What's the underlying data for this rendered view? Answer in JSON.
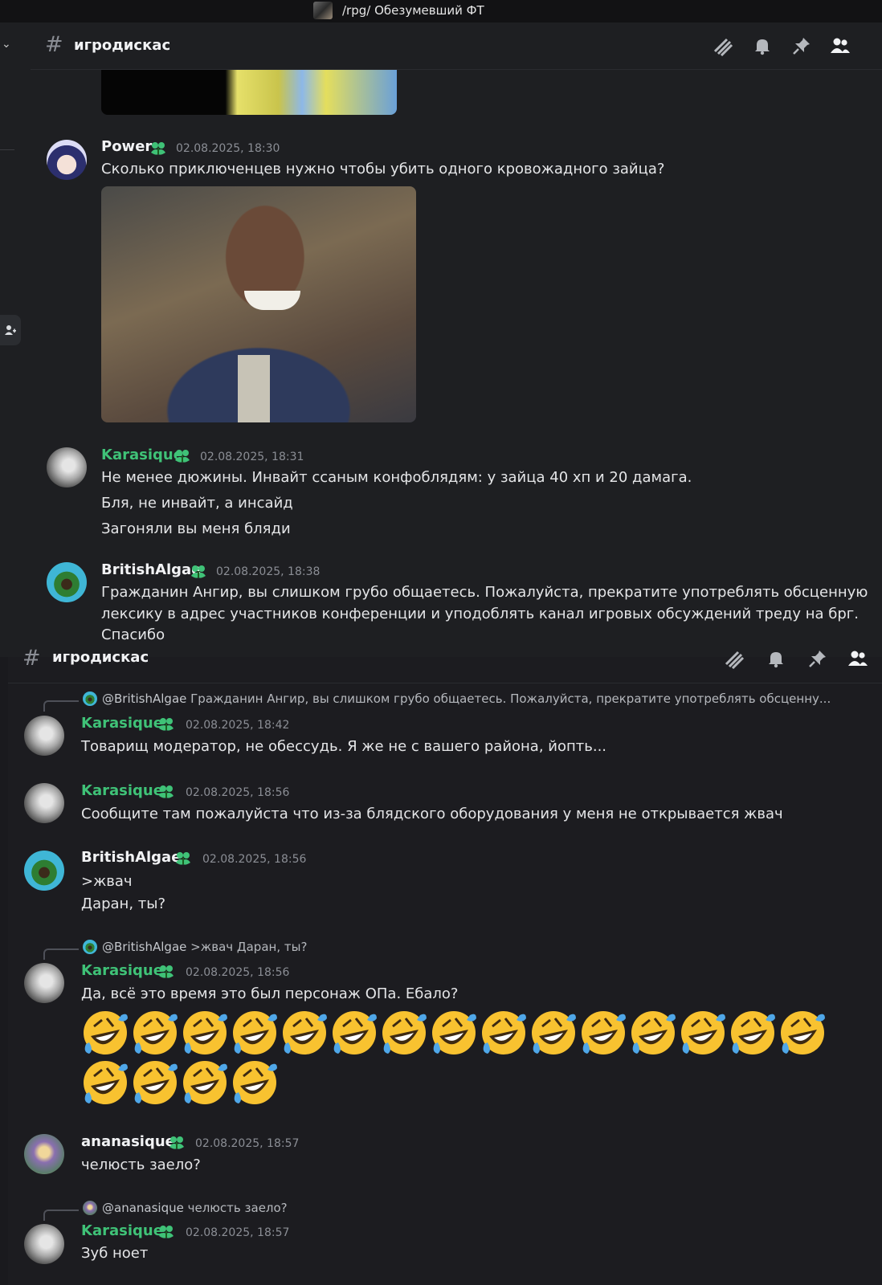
{
  "window": {
    "server_title": "/rpg/ Обезумевший ФТ"
  },
  "pane1": {
    "channel_name": "игродискас",
    "messages": [
      {
        "author": "Power",
        "timestamp": "02.08.2025, 18:30",
        "text": "Сколько приключенцев нужно чтобы убить одного кровожадного зайца?"
      },
      {
        "author": "Karasique",
        "timestamp": "02.08.2025, 18:31",
        "lines": [
          "Не менее дюжины. Инвайт ссаным конфоблядям: у зайца 40 хп и 20 дамага.",
          "Бля, не инвайт, а инсайд",
          "Загоняли вы меня бляди"
        ]
      },
      {
        "author": "BritishAlgae",
        "timestamp": "02.08.2025, 18:38",
        "lines": [
          "Гражданин Ангир, вы слишком грубо общаетесь. Пожалуйста, прекратите употреблять обсценную",
          "лексику в адрес участников конференции и уподоблять канал игровых обсуждений треду на брг.",
          "Спасибо"
        ]
      }
    ]
  },
  "pane2": {
    "channel_name": "игродискас",
    "messages": [
      {
        "reply_to": "@BritishAlgae",
        "reply_text": "Гражданин Ангир, вы слишком грубо общаетесь. Пожалуйста, прекратите употреблять обсценну...",
        "author": "Karasique",
        "timestamp": "02.08.2025, 18:42",
        "text": "Товарищ модератор, не обессудь. Я же не с вашего района, йопть..."
      },
      {
        "author": "Karasique",
        "timestamp": "02.08.2025, 18:56",
        "text": "Сообщите там пожалуйста что из-за блядского оборудования у меня не открывается жвач"
      },
      {
        "author": "BritishAlgae",
        "timestamp": "02.08.2025, 18:56",
        "lines": [
          ">жвач",
          "Даран, ты?"
        ]
      },
      {
        "reply_to": "@BritishAlgae",
        "reply_text": ">жвач Даран, ты?",
        "author": "Karasique",
        "timestamp": "02.08.2025, 18:56",
        "text": "Да, всё это время это был персонаж ОПа. Ебало?",
        "emoji": "rofl",
        "emoji_count": 19
      },
      {
        "author": "ananasique",
        "timestamp": "02.08.2025, 18:57",
        "text": "челюсть заело?"
      },
      {
        "reply_to": "@ananasique",
        "reply_text": "челюсть заело?",
        "author": "Karasique",
        "timestamp": "02.08.2025, 18:57",
        "text": "Зуб ноет"
      }
    ]
  },
  "icons": [
    "threads-icon",
    "bell-icon",
    "pin-icon",
    "members-icon",
    "add-member-icon",
    "chevron-down-icon",
    "hash-icon",
    "member-badge-icon",
    "rofl-emoji"
  ],
  "colors": {
    "background": "#1e1f22",
    "username_green": "#3fc277",
    "text": "#e4e5e7",
    "timestamp": "#8b8e95"
  }
}
